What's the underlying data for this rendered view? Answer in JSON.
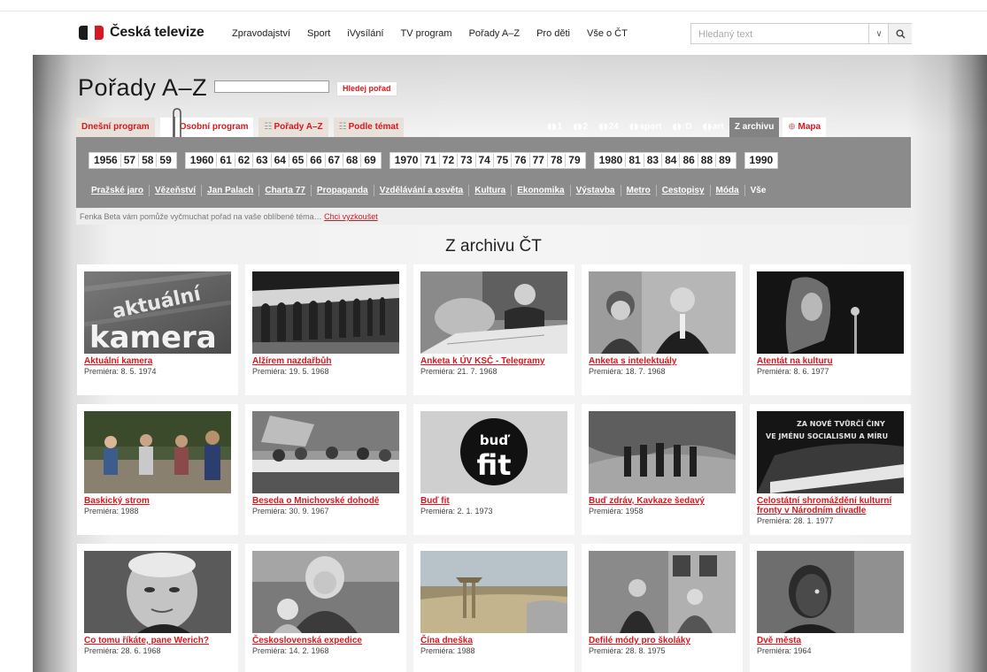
{
  "brand": {
    "name": "Česká televize"
  },
  "nav": [
    "Zpravodajství",
    "Sport",
    "iVysílání",
    "TV program",
    "Pořady A–Z",
    "Pro děti",
    "Vše o ČT"
  ],
  "search": {
    "placeholder": "Hledaný text"
  },
  "page": {
    "title": "Pořady A–Z",
    "find_button": "Hledej pořad"
  },
  "tabs": [
    {
      "label": "Dnešní program",
      "icon": "",
      "active": false
    },
    {
      "label": "Osobní program",
      "icon": "",
      "active": true
    },
    {
      "label": "Pořady A–Z",
      "icon": "list-icon",
      "active": false
    },
    {
      "label": "Podle témat",
      "icon": "list-icon",
      "active": false
    }
  ],
  "channels": [
    {
      "label": "1",
      "logo": true
    },
    {
      "label": "2",
      "logo": true
    },
    {
      "label": "24",
      "logo": true
    },
    {
      "label": "sport",
      "logo": true
    },
    {
      "label": ":D",
      "logo": true
    },
    {
      "label": "art",
      "logo": true
    },
    {
      "label": "Z archivu",
      "logo": false,
      "active": true
    },
    {
      "label": "Mapa",
      "logo": false,
      "map": true
    }
  ],
  "years": [
    [
      "1956",
      "57",
      "58",
      "59"
    ],
    [
      "1960",
      "61",
      "62",
      "63",
      "64",
      "65",
      "66",
      "67",
      "68",
      "69"
    ],
    [
      "1970",
      "71",
      "72",
      "73",
      "74",
      "75",
      "76",
      "77",
      "78",
      "79"
    ],
    [
      "1980",
      "81",
      "83",
      "84",
      "86",
      "88",
      "89"
    ],
    [
      "1990"
    ]
  ],
  "themes": [
    "Pražské jaro",
    "Vězeňství",
    "Jan Palach",
    "Charta 77",
    "Propaganda",
    "Vzdělávání a osvěta",
    "Kultura",
    "Ekonomika",
    "Výstavba",
    "Metro",
    "Cestopisy",
    "Móda",
    "Vše"
  ],
  "hint": {
    "text": "Fenka Beta vám pomůže vyčmuchat pořad na vaše oblíbené téma…",
    "link": "Chci vyzkoušet"
  },
  "section": {
    "title": "Z archivu ČT"
  },
  "thumb_overlay": {
    "aktualni": "aktuální",
    "kamera": "kamera",
    "bud": "buď",
    "fit": "fit",
    "banner1": "ZA NOVÉ TVŮRČÍ ČINY",
    "banner2": "VE JMÉNU SOCIALISMU A MÍRU"
  },
  "colors": {
    "accent_red": "#d8181f",
    "panel_gray": "#8b8b8b",
    "tab_beige": "#e7e1da"
  },
  "cards": [
    {
      "title": "Aktuální kamera",
      "premiere": "Premiéra: 8. 5. 1974"
    },
    {
      "title": "Alžírem nazdařbůh",
      "premiere": "Premiéra: 19. 5. 1968"
    },
    {
      "title": "Anketa k ÚV KSČ - Telegramy",
      "premiere": "Premiéra: 21. 7. 1968"
    },
    {
      "title": "Anketa s intelektuály",
      "premiere": "Premiéra: 18. 7. 1968"
    },
    {
      "title": "Atentát na kulturu",
      "premiere": "Premiéra: 8. 6. 1977"
    },
    {
      "title": "Baskický strom",
      "premiere": "Premiéra: 1988"
    },
    {
      "title": "Beseda o Mnichovské dohodě",
      "premiere": "Premiéra: 30. 9. 1967"
    },
    {
      "title": "Buď fit",
      "premiere": "Premiéra: 2. 1. 1973"
    },
    {
      "title": "Buď zdráv, Kavkaze šedavý",
      "premiere": "Premiéra: 1958"
    },
    {
      "title": "Celostátní shromáždění kulturní fronty v Národním divadle",
      "premiere": "Premiéra: 28. 1. 1977"
    },
    {
      "title": "Co tomu říkáte, pane Werich?",
      "premiere": "Premiéra: 28. 6. 1968"
    },
    {
      "title": "Československá expedice",
      "premiere": "Premiéra: 14. 2. 1968"
    },
    {
      "title": "Čína dneška",
      "premiere": "Premiéra: 1988"
    },
    {
      "title": "Defilé módy pro školáky",
      "premiere": "Premiéra: 28. 8. 1975"
    },
    {
      "title": "Dvě města",
      "premiere": "Premiéra: 1964"
    }
  ]
}
